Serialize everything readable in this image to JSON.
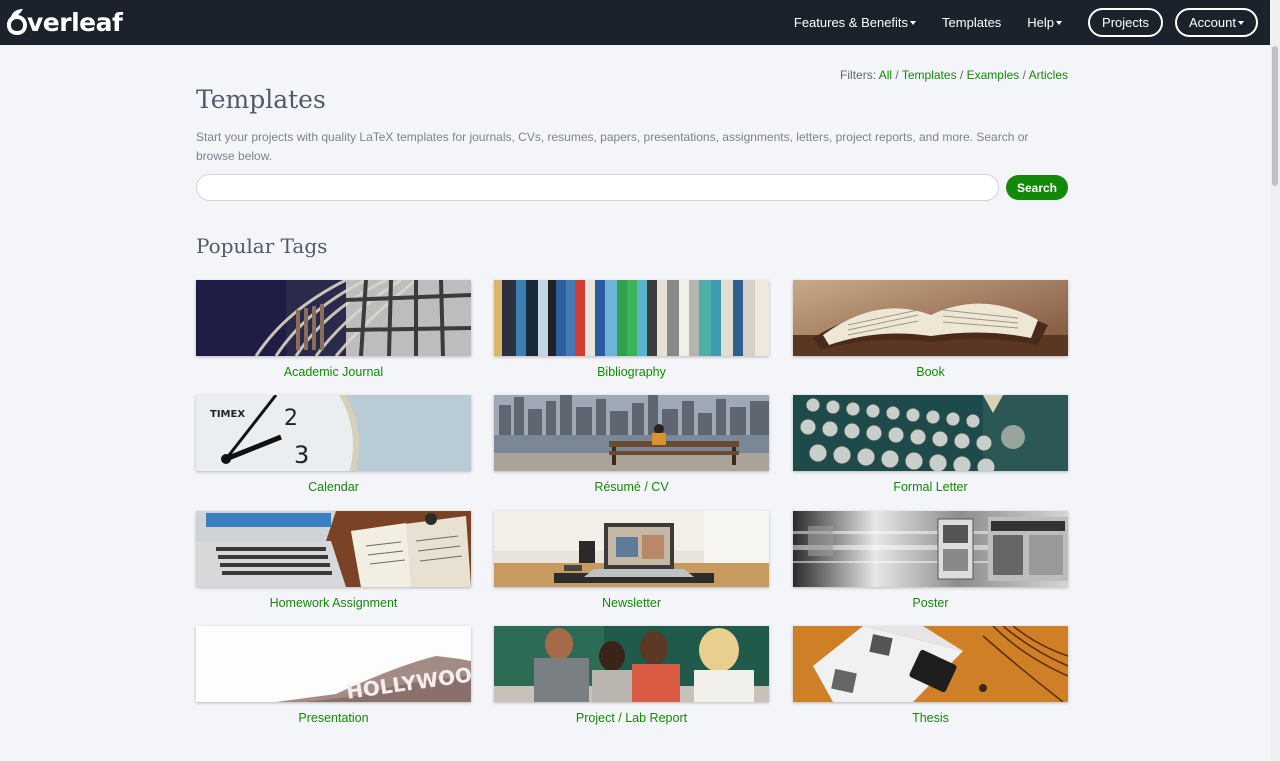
{
  "navbar": {
    "logo": "Overleaf",
    "links": [
      {
        "label": "Features & Benefits",
        "dropdown": true
      },
      {
        "label": "Templates",
        "dropdown": false
      },
      {
        "label": "Help",
        "dropdown": true
      }
    ],
    "projects_label": "Projects",
    "account_label": "Account"
  },
  "filters": {
    "prefix": "Filters:",
    "items": [
      "All",
      "Templates",
      "Examples",
      "Articles"
    ],
    "separator": "/"
  },
  "page": {
    "title": "Templates",
    "intro": "Start your projects with quality LaTeX templates for journals, CVs, resumes, papers, presentations, assignments, letters, project reports, and more. Search or browse below."
  },
  "search": {
    "value": "",
    "placeholder": "",
    "button_label": "Search"
  },
  "popular_tags": {
    "title": "Popular Tags",
    "tags": [
      {
        "label": "Academic Journal",
        "image": "library-shelves-image"
      },
      {
        "label": "Bibliography",
        "image": "book-spines-image"
      },
      {
        "label": "Book",
        "image": "open-book-image"
      },
      {
        "label": "Calendar",
        "image": "clock-face-image"
      },
      {
        "label": "Résumé / CV",
        "image": "city-waterfront-image"
      },
      {
        "label": "Formal Letter",
        "image": "typewriter-image"
      },
      {
        "label": "Homework Assignment",
        "image": "laptop-notebook-image"
      },
      {
        "label": "Newsletter",
        "image": "desk-laptop-image"
      },
      {
        "label": "Poster",
        "image": "motion-blur-posters-image"
      },
      {
        "label": "Presentation",
        "image": "hollywood-sign-image"
      },
      {
        "label": "Project / Lab Report",
        "image": "students-classroom-image"
      },
      {
        "label": "Thesis",
        "image": "magazine-desk-image"
      }
    ]
  },
  "colors": {
    "navbar_bg": "#1b222c",
    "accent_green": "#138a07",
    "page_bg": "#f4f5f8"
  }
}
